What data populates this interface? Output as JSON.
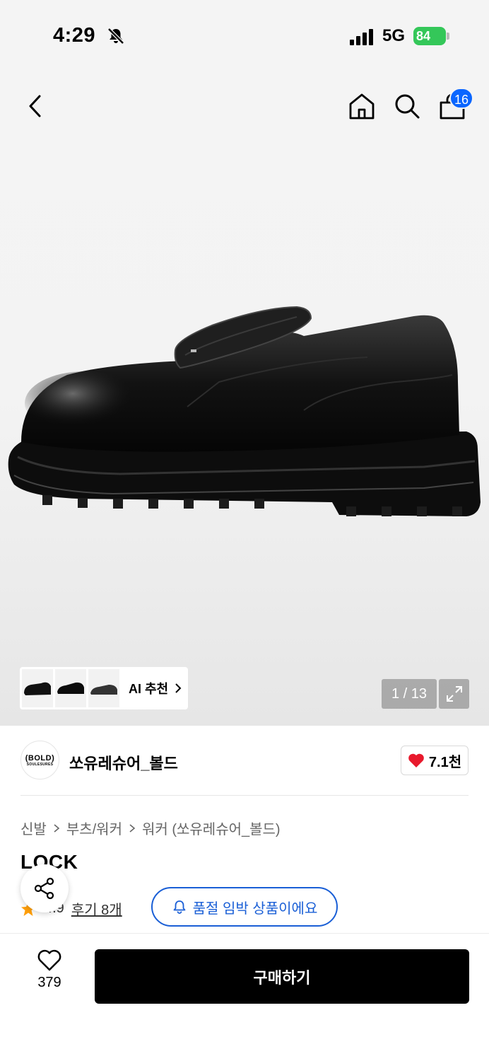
{
  "status_bar": {
    "time": "4:29",
    "network": "5G",
    "battery": "84"
  },
  "nav": {
    "cart_count": "16"
  },
  "gallery": {
    "ai_label": "AI 추천",
    "page_counter": "1 / 13"
  },
  "brand": {
    "logo_main": "(BOLD)",
    "logo_sub": "SOULESURES",
    "name": "쏘유레슈어_볼드",
    "like_count": "7.1천"
  },
  "breadcrumb": [
    "신발",
    "부츠/워커",
    "워커 (쏘유레슈어_볼드)"
  ],
  "product": {
    "title": "LOCK",
    "rating": "4.9",
    "review_link": "후기 8개",
    "stock_notice": "품절 임박 상품이에요"
  },
  "bottom_bar": {
    "wish_count": "379",
    "buy_label": "구매하기"
  },
  "colors": {
    "accent_blue": "#1a5fd6",
    "badge_blue": "#0a66ff",
    "battery_green": "#34c759",
    "heart_red": "#e8192c",
    "star_orange": "#ff9f0a"
  }
}
